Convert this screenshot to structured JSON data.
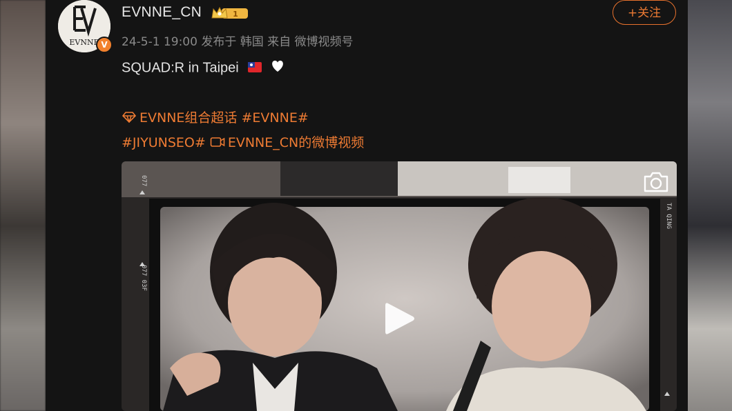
{
  "post": {
    "username": "EVNNE_CN",
    "avatar_text": "EVNNE",
    "verified_mark": "V",
    "level_badge": "1",
    "meta": "24-5-1 19:00  发布于 韩国  来自 微博视频号",
    "follow_label": "+关注",
    "text": "SQUAD:R in Taipei",
    "links": {
      "super_topic": "EVNNE组合超话",
      "hashtag_evnne": "#EVNNE#",
      "hashtag_jiyunseo": "#JIYUNSEO#",
      "video_source": "EVNNE_CN的微博视频"
    },
    "video": {
      "film_marks": [
        "077",
        "077  03F",
        "TA QING"
      ]
    }
  },
  "icons": {
    "crown": "crown-icon",
    "diamond": "super-topic-diamond-icon",
    "video": "video-camera-icon",
    "play": "play-icon",
    "camera": "camera-icon",
    "flag": "taiwan-flag-emoji",
    "heart": "white-heart-emoji"
  },
  "colors": {
    "accent": "#ee7b33",
    "background": "#141414",
    "text": "#e3e3e3",
    "meta": "#8a8a8a"
  }
}
